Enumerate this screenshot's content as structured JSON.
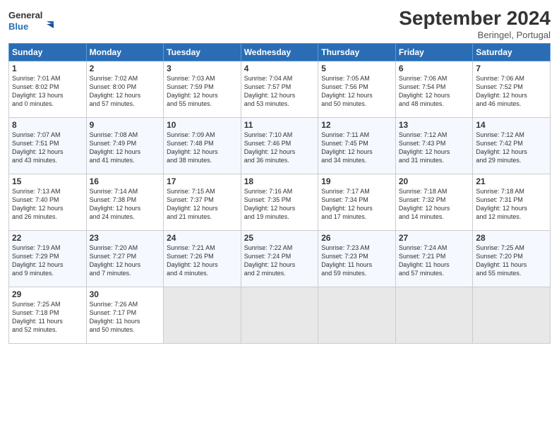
{
  "header": {
    "logo_line1": "General",
    "logo_line2": "Blue",
    "month": "September 2024",
    "location": "Beringel, Portugal"
  },
  "days_of_week": [
    "Sunday",
    "Monday",
    "Tuesday",
    "Wednesday",
    "Thursday",
    "Friday",
    "Saturday"
  ],
  "weeks": [
    [
      {
        "day": "1",
        "text": "Sunrise: 7:01 AM\nSunset: 8:02 PM\nDaylight: 13 hours\nand 0 minutes."
      },
      {
        "day": "2",
        "text": "Sunrise: 7:02 AM\nSunset: 8:00 PM\nDaylight: 12 hours\nand 57 minutes."
      },
      {
        "day": "3",
        "text": "Sunrise: 7:03 AM\nSunset: 7:59 PM\nDaylight: 12 hours\nand 55 minutes."
      },
      {
        "day": "4",
        "text": "Sunrise: 7:04 AM\nSunset: 7:57 PM\nDaylight: 12 hours\nand 53 minutes."
      },
      {
        "day": "5",
        "text": "Sunrise: 7:05 AM\nSunset: 7:56 PM\nDaylight: 12 hours\nand 50 minutes."
      },
      {
        "day": "6",
        "text": "Sunrise: 7:06 AM\nSunset: 7:54 PM\nDaylight: 12 hours\nand 48 minutes."
      },
      {
        "day": "7",
        "text": "Sunrise: 7:06 AM\nSunset: 7:52 PM\nDaylight: 12 hours\nand 46 minutes."
      }
    ],
    [
      {
        "day": "8",
        "text": "Sunrise: 7:07 AM\nSunset: 7:51 PM\nDaylight: 12 hours\nand 43 minutes."
      },
      {
        "day": "9",
        "text": "Sunrise: 7:08 AM\nSunset: 7:49 PM\nDaylight: 12 hours\nand 41 minutes."
      },
      {
        "day": "10",
        "text": "Sunrise: 7:09 AM\nSunset: 7:48 PM\nDaylight: 12 hours\nand 38 minutes."
      },
      {
        "day": "11",
        "text": "Sunrise: 7:10 AM\nSunset: 7:46 PM\nDaylight: 12 hours\nand 36 minutes."
      },
      {
        "day": "12",
        "text": "Sunrise: 7:11 AM\nSunset: 7:45 PM\nDaylight: 12 hours\nand 34 minutes."
      },
      {
        "day": "13",
        "text": "Sunrise: 7:12 AM\nSunset: 7:43 PM\nDaylight: 12 hours\nand 31 minutes."
      },
      {
        "day": "14",
        "text": "Sunrise: 7:12 AM\nSunset: 7:42 PM\nDaylight: 12 hours\nand 29 minutes."
      }
    ],
    [
      {
        "day": "15",
        "text": "Sunrise: 7:13 AM\nSunset: 7:40 PM\nDaylight: 12 hours\nand 26 minutes."
      },
      {
        "day": "16",
        "text": "Sunrise: 7:14 AM\nSunset: 7:38 PM\nDaylight: 12 hours\nand 24 minutes."
      },
      {
        "day": "17",
        "text": "Sunrise: 7:15 AM\nSunset: 7:37 PM\nDaylight: 12 hours\nand 21 minutes."
      },
      {
        "day": "18",
        "text": "Sunrise: 7:16 AM\nSunset: 7:35 PM\nDaylight: 12 hours\nand 19 minutes."
      },
      {
        "day": "19",
        "text": "Sunrise: 7:17 AM\nSunset: 7:34 PM\nDaylight: 12 hours\nand 17 minutes."
      },
      {
        "day": "20",
        "text": "Sunrise: 7:18 AM\nSunset: 7:32 PM\nDaylight: 12 hours\nand 14 minutes."
      },
      {
        "day": "21",
        "text": "Sunrise: 7:18 AM\nSunset: 7:31 PM\nDaylight: 12 hours\nand 12 minutes."
      }
    ],
    [
      {
        "day": "22",
        "text": "Sunrise: 7:19 AM\nSunset: 7:29 PM\nDaylight: 12 hours\nand 9 minutes."
      },
      {
        "day": "23",
        "text": "Sunrise: 7:20 AM\nSunset: 7:27 PM\nDaylight: 12 hours\nand 7 minutes."
      },
      {
        "day": "24",
        "text": "Sunrise: 7:21 AM\nSunset: 7:26 PM\nDaylight: 12 hours\nand 4 minutes."
      },
      {
        "day": "25",
        "text": "Sunrise: 7:22 AM\nSunset: 7:24 PM\nDaylight: 12 hours\nand 2 minutes."
      },
      {
        "day": "26",
        "text": "Sunrise: 7:23 AM\nSunset: 7:23 PM\nDaylight: 11 hours\nand 59 minutes."
      },
      {
        "day": "27",
        "text": "Sunrise: 7:24 AM\nSunset: 7:21 PM\nDaylight: 11 hours\nand 57 minutes."
      },
      {
        "day": "28",
        "text": "Sunrise: 7:25 AM\nSunset: 7:20 PM\nDaylight: 11 hours\nand 55 minutes."
      }
    ],
    [
      {
        "day": "29",
        "text": "Sunrise: 7:25 AM\nSunset: 7:18 PM\nDaylight: 11 hours\nand 52 minutes."
      },
      {
        "day": "30",
        "text": "Sunrise: 7:26 AM\nSunset: 7:17 PM\nDaylight: 11 hours\nand 50 minutes."
      },
      {
        "day": "",
        "text": ""
      },
      {
        "day": "",
        "text": ""
      },
      {
        "day": "",
        "text": ""
      },
      {
        "day": "",
        "text": ""
      },
      {
        "day": "",
        "text": ""
      }
    ]
  ]
}
